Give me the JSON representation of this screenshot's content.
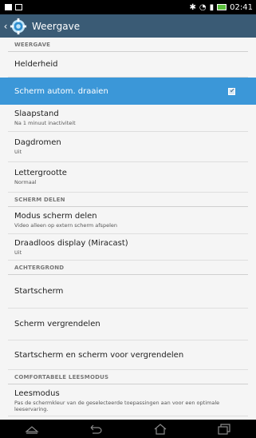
{
  "statusbar": {
    "time": "02:41"
  },
  "actionbar": {
    "title": "Weergave"
  },
  "list": {
    "sections": {
      "weergave": "WEERGAVE",
      "scherm_delen": "SCHERM DELEN",
      "achtergrond": "ACHTERGROND",
      "comfortabele": "COMFORTABELE LEESMODUS"
    },
    "items": {
      "helderheid": {
        "title": "Helderheid"
      },
      "autorotate": {
        "title": "Scherm autom. draaien",
        "checked": true
      },
      "slaapstand": {
        "title": "Slaapstand",
        "summary": "Na 1 minuut inactiviteit"
      },
      "dagdromen": {
        "title": "Dagdromen",
        "summary": "Uit"
      },
      "lettergrootte": {
        "title": "Lettergrootte",
        "summary": "Normaal"
      },
      "modus_scherm_delen": {
        "title": "Modus scherm delen",
        "summary": "Video alleen op extern scherm afspelen"
      },
      "draadloos": {
        "title": "Draadloos display (Miracast)",
        "summary": "Uit"
      },
      "startscherm": {
        "title": "Startscherm"
      },
      "vergrendelen": {
        "title": "Scherm vergrendelen"
      },
      "beide": {
        "title": "Startscherm en scherm voor vergrendelen"
      },
      "leesmodus": {
        "title": "Leesmodus",
        "summary": "Pas de schermkleur van de geselecteerde toepassingen aan voor een optimale leeservaring."
      }
    }
  },
  "colors": {
    "actionbar": "#3a5b75",
    "selected": "#3b97d8"
  },
  "navbar": {
    "icons": [
      "collapse-icon",
      "back-icon",
      "home-icon",
      "recent-apps-icon"
    ]
  }
}
